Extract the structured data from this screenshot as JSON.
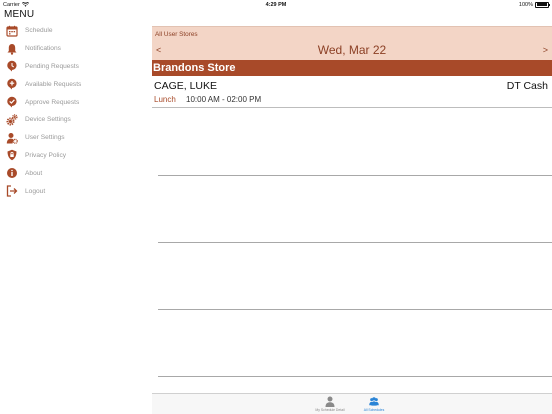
{
  "status_bar": {
    "carrier": "Carrier",
    "time": "4:29 PM",
    "battery": "100%"
  },
  "menu": {
    "title": "MENU",
    "items": [
      {
        "label": "Schedule",
        "icon": "calendar-icon"
      },
      {
        "label": "Notifications",
        "icon": "bell-icon"
      },
      {
        "label": "Pending Requests",
        "icon": "pending-icon"
      },
      {
        "label": "Available Requests",
        "icon": "available-icon"
      },
      {
        "label": "Approve Requests",
        "icon": "approve-icon"
      },
      {
        "label": "Device Settings",
        "icon": "gears-icon"
      },
      {
        "label": "User Settings",
        "icon": "user-settings-icon"
      },
      {
        "label": "Privacy Policy",
        "icon": "shield-icon"
      },
      {
        "label": "About",
        "icon": "info-icon"
      },
      {
        "label": "Logout",
        "icon": "logout-icon"
      }
    ],
    "icon_color": "#a84a29"
  },
  "header": {
    "store_filter": "All User Stores",
    "prev": "<",
    "next": ">",
    "date": "Wed, Mar 22",
    "background_color": "#f3d5c6",
    "accent_color": "#8b3f24"
  },
  "store": {
    "name": "Brandons Store",
    "background_color": "#a84a29"
  },
  "shifts": [
    {
      "employee": "CAGE, LUKE",
      "department": "DT Cash",
      "break_label": "Lunch",
      "time": "10:00 AM - 02:00 PM"
    }
  ],
  "tabs": [
    {
      "label": "My Schedule Detail",
      "icon": "person-icon",
      "active": false
    },
    {
      "label": "All Schedules",
      "icon": "group-icon",
      "active": true
    }
  ]
}
